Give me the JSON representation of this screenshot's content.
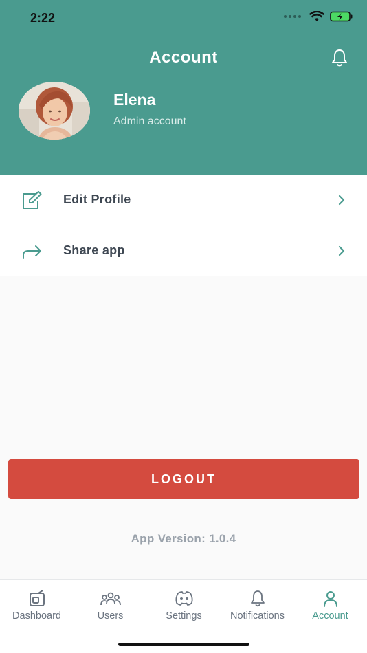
{
  "status_bar": {
    "time": "2:22",
    "icons": [
      "signal-dots-icon",
      "wifi-icon",
      "battery-charging-icon"
    ]
  },
  "header": {
    "title": "Account",
    "notification_icon": "bell-icon",
    "background_color": "#4a9b8f"
  },
  "profile": {
    "name": "Elena",
    "role": "Admin account",
    "avatar": "avatar-photo"
  },
  "menu": {
    "items": [
      {
        "label": "Edit Profile",
        "icon": "edit-icon"
      },
      {
        "label": "Share app",
        "icon": "share-icon"
      }
    ]
  },
  "logout": {
    "label": "LOGOUT",
    "color": "#d44b3f"
  },
  "app_version": "App Version: 1.0.4",
  "tabbar": {
    "active": "Account",
    "active_color": "#4a9b8f",
    "tabs": [
      {
        "label": "Dashboard",
        "icon": "dashboard-icon"
      },
      {
        "label": "Users",
        "icon": "users-icon"
      },
      {
        "label": "Settings",
        "icon": "discord-icon"
      },
      {
        "label": "Notifications",
        "icon": "bell-icon"
      },
      {
        "label": "Account",
        "icon": "person-icon"
      }
    ]
  }
}
